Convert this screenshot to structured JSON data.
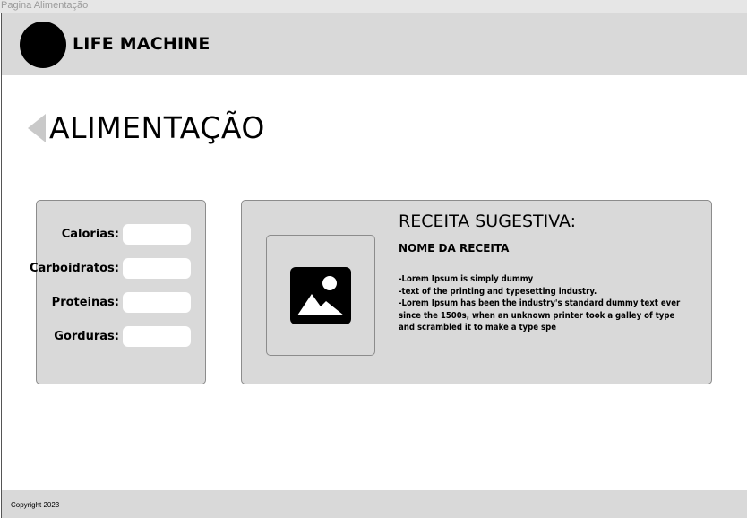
{
  "window": {
    "title": "Pagina Alimentação"
  },
  "header": {
    "brand": "LIFE MACHINE"
  },
  "page": {
    "title": "ALIMENTAÇÃO"
  },
  "nutrients": {
    "fields": [
      {
        "label": "Calorias:",
        "value": ""
      },
      {
        "label": "Carboidratos:",
        "value": ""
      },
      {
        "label": "Proteinas:",
        "value": ""
      },
      {
        "label": "Gorduras:",
        "value": ""
      }
    ]
  },
  "recipe": {
    "heading": "RECEITA SUGESTIVA:",
    "name": "NOME DA RECEITA",
    "lines": [
      "-Lorem Ipsum is simply dummy",
      "-text of the printing and typesetting industry.",
      "-Lorem Ipsum has been the industry's standard dummy text ever",
      "since the 1500s, when an unknown printer took a galley of type",
      "and scrambled it to make a type spe"
    ],
    "image_icon": "image-placeholder-icon"
  },
  "footer": {
    "copyright": "Copyright 2023"
  },
  "colors": {
    "panel": "#d9d9d9",
    "header": "#d9d9d9",
    "back_arrow": "#c9c9c9"
  }
}
